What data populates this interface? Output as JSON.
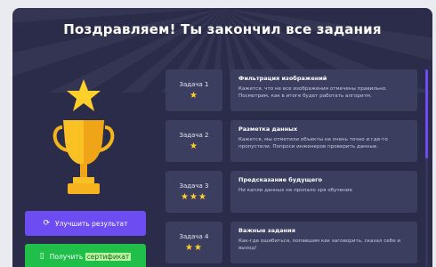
{
  "header": {
    "title": "Поздравляем! Ты закончил все задания"
  },
  "actions": {
    "improve_label": "Улучшить результат",
    "certificate_prefix": "Получить ",
    "certificate_highlight": "сертификат"
  },
  "tasks": [
    {
      "label": "Задача 1",
      "stars": "★",
      "title": "Фильтрация изображений",
      "text": "Кажется, что не все изображения отмечены правильно. Посмотрим, как в итоге будет работать алгоритм."
    },
    {
      "label": "Задача 2",
      "stars": "★",
      "title": "Разметка данных",
      "text": "Кажется, мы отметили объекты не очень точно и где-то пропустили. Попроси инженеров проверить данные."
    },
    {
      "label": "Задача 3",
      "stars": "★★★",
      "title": "Предсказание будущего",
      "text": "Ни капли данных не пропало зря обучение"
    },
    {
      "label": "Задача 4",
      "stars": "★★",
      "title": "Важные задания",
      "text": "Как-где ошибиться, попавшим как заговорить, сказал себе и выход!"
    }
  ]
}
